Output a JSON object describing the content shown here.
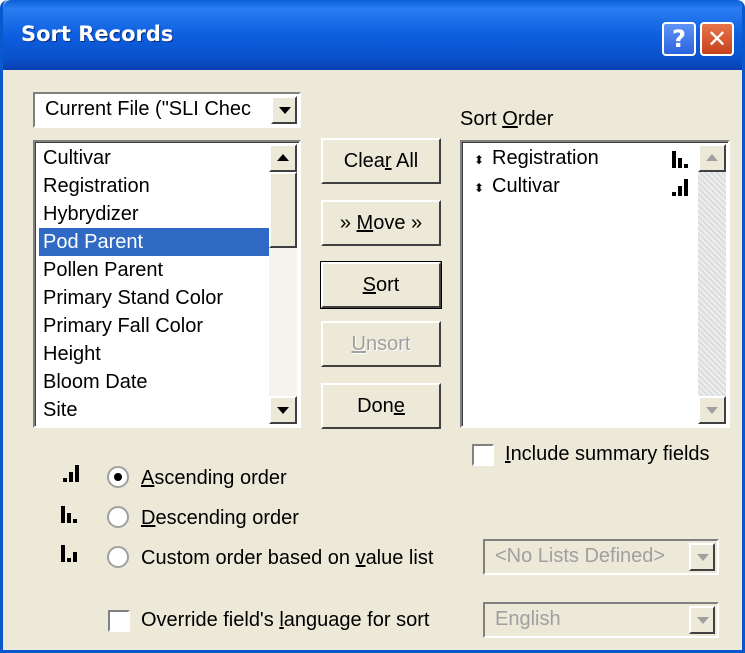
{
  "window": {
    "title": "Sort Records",
    "help_label": "?",
    "close_label": "✕"
  },
  "file_combo": {
    "value": "Current File (\"SLI Chec"
  },
  "fields": [
    "Cultivar",
    "Registration",
    "Hybrydizer",
    "Pod Parent",
    "Pollen Parent",
    "Primary Stand Color",
    "Primary Fall Color",
    "Height",
    "Bloom Date",
    "Site"
  ],
  "fields_selected": "Pod Parent",
  "buttons": {
    "clear_all_pre": "Clea",
    "clear_all_key": "r",
    "clear_all_post": " All",
    "move_pre": "» ",
    "move_key": "M",
    "move_post": "ove »",
    "sort_key": "S",
    "sort_post": "ort",
    "unsort_key": "U",
    "unsort_post": "nsort",
    "done_pre": "Don",
    "done_key": "e"
  },
  "sort_order": {
    "label_pre": "Sort ",
    "label_key": "O",
    "label_post": "rder",
    "items": [
      {
        "name": "Registration",
        "direction": "descending"
      },
      {
        "name": "Cultivar",
        "direction": "ascending"
      }
    ]
  },
  "include_summary": {
    "label_key": "I",
    "label_post": "nclude summary fields",
    "checked": false
  },
  "order_options": {
    "ascending": {
      "key": "A",
      "post": "scending order",
      "checked": true
    },
    "descending": {
      "key": "D",
      "post": "escending order",
      "checked": false
    },
    "custom": {
      "pre": "Custom order based on ",
      "key": "v",
      "post": "alue list",
      "checked": false
    }
  },
  "value_list_combo": {
    "value": "<No Lists Defined>"
  },
  "override_language": {
    "pre": "Override field's ",
    "key": "l",
    "post": "anguage for sort",
    "checked": false
  },
  "language_combo": {
    "value": "English"
  }
}
